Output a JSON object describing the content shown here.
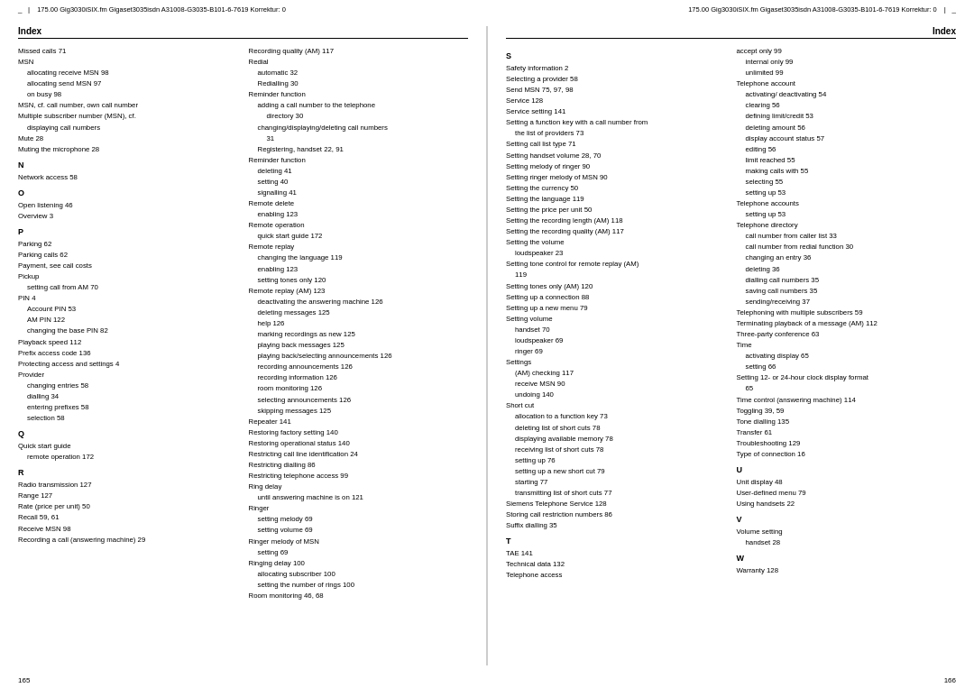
{
  "header": {
    "left_corner": "_",
    "left_info": "175.00    Gig3030iSIX.fm  Gigaset3035isdn  A31008-G3035-B101-6-7619  Korrektur: 0",
    "right_info": "175.00    Gig3030iSIX.fm  Gigaset3035isdn  A31008-G3035-B101-6-7619  Korrektur: 0",
    "right_corner": "_"
  },
  "left_page": {
    "title": "Index",
    "page_number": "165",
    "columns": {
      "col1": [
        {
          "type": "text",
          "content": "Missed calls 71"
        },
        {
          "type": "text",
          "content": "MSN"
        },
        {
          "type": "indent1",
          "content": "allocating receive MSN 98"
        },
        {
          "type": "indent1",
          "content": "allocating send MSN 97"
        },
        {
          "type": "indent1",
          "content": "on busy 98"
        },
        {
          "type": "text",
          "content": "MSN, cf. call number, own call number"
        },
        {
          "type": "text",
          "content": "Multiple subscriber number (MSN), cf."
        },
        {
          "type": "indent1",
          "content": "displaying call numbers"
        },
        {
          "type": "text",
          "content": "Mute 28"
        },
        {
          "type": "text",
          "content": "Muting the microphone 28"
        },
        {
          "type": "section",
          "content": "N"
        },
        {
          "type": "text",
          "content": "Network access 58"
        },
        {
          "type": "section",
          "content": "O"
        },
        {
          "type": "text",
          "content": "Open listening 46"
        },
        {
          "type": "text",
          "content": "Overview 3"
        },
        {
          "type": "section",
          "content": "P"
        },
        {
          "type": "text",
          "content": "Parking 62"
        },
        {
          "type": "text",
          "content": "Parking calls 62"
        },
        {
          "type": "text",
          "content": "Payment, see call costs"
        },
        {
          "type": "text",
          "content": "Pickup"
        },
        {
          "type": "indent1",
          "content": "setting call from AM 70"
        },
        {
          "type": "text",
          "content": "PIN 4"
        },
        {
          "type": "indent1",
          "content": "Account PIN 53"
        },
        {
          "type": "indent1",
          "content": "AM PIN 122"
        },
        {
          "type": "indent1",
          "content": "changing the base PIN 82"
        },
        {
          "type": "text",
          "content": "Playback speed 112"
        },
        {
          "type": "text",
          "content": "Prefix access code 136"
        },
        {
          "type": "text",
          "content": "Protecting access and settings 4"
        },
        {
          "type": "text",
          "content": "Provider"
        },
        {
          "type": "indent1",
          "content": "changing entries 58"
        },
        {
          "type": "indent1",
          "content": "dialling 34"
        },
        {
          "type": "indent1",
          "content": "entering prefixes 58"
        },
        {
          "type": "indent1",
          "content": "selection 58"
        },
        {
          "type": "section",
          "content": "Q"
        },
        {
          "type": "text",
          "content": "Quick start guide"
        },
        {
          "type": "indent1",
          "content": "remote operation 172"
        },
        {
          "type": "section",
          "content": "R"
        },
        {
          "type": "text",
          "content": "Radio transmission 127"
        },
        {
          "type": "text",
          "content": "Range 127"
        },
        {
          "type": "text",
          "content": "Rate (price per unit) 50"
        },
        {
          "type": "text",
          "content": "Recall 59, 61"
        },
        {
          "type": "text",
          "content": "Receive MSN 98"
        },
        {
          "type": "text",
          "content": "Recording a call (answering machine) 29"
        }
      ],
      "col2": [
        {
          "type": "text",
          "content": "Recording quality (AM) 117"
        },
        {
          "type": "text",
          "content": "Redial"
        },
        {
          "type": "indent1",
          "content": "automatic 32"
        },
        {
          "type": "indent1",
          "content": "Redialling 30"
        },
        {
          "type": "text",
          "content": "Reminder function"
        },
        {
          "type": "indent1",
          "content": "adding a call number to the telephone"
        },
        {
          "type": "indent2",
          "content": "directory 30"
        },
        {
          "type": "indent1",
          "content": "changing/displaying/deleting call numbers"
        },
        {
          "type": "indent2",
          "content": "31"
        },
        {
          "type": "indent1",
          "content": "Registering, handset 22, 91"
        },
        {
          "type": "text",
          "content": "Reminder function"
        },
        {
          "type": "indent1",
          "content": "deleting 41"
        },
        {
          "type": "indent1",
          "content": "setting 40"
        },
        {
          "type": "indent1",
          "content": "signalling 41"
        },
        {
          "type": "text",
          "content": "Remote delete"
        },
        {
          "type": "indent1",
          "content": "enabling 123"
        },
        {
          "type": "text",
          "content": "Remote operation"
        },
        {
          "type": "indent1",
          "content": "quick start guide 172"
        },
        {
          "type": "text",
          "content": "Remote replay"
        },
        {
          "type": "indent1",
          "content": "changing the language 119"
        },
        {
          "type": "indent1",
          "content": "enabling 123"
        },
        {
          "type": "indent1",
          "content": "setting tones only 120"
        },
        {
          "type": "text",
          "content": "Remote replay (AM) 123"
        },
        {
          "type": "indent1",
          "content": "deactivating the answering machine 126"
        },
        {
          "type": "indent1",
          "content": "deleting messages 125"
        },
        {
          "type": "indent1",
          "content": "help 126"
        },
        {
          "type": "indent1",
          "content": "marking recordings as new 125"
        },
        {
          "type": "indent1",
          "content": "playing back messages 125"
        },
        {
          "type": "indent1",
          "content": "playing back/selecting announcements 126"
        },
        {
          "type": "indent1",
          "content": "recording announcements 126"
        },
        {
          "type": "indent1",
          "content": "recording information 126"
        },
        {
          "type": "indent1",
          "content": "room monitoring 126"
        },
        {
          "type": "indent1",
          "content": "selecting announcements 126"
        },
        {
          "type": "indent1",
          "content": "skipping messages 125"
        },
        {
          "type": "text",
          "content": "Repeater 141"
        },
        {
          "type": "text",
          "content": "Restoring factory setting 140"
        },
        {
          "type": "text",
          "content": "Restoring operational status 140"
        },
        {
          "type": "text",
          "content": "Restricting call line identification 24"
        },
        {
          "type": "text",
          "content": "Restricting dialling 86"
        },
        {
          "type": "text",
          "content": "Restricting telephone access 99"
        },
        {
          "type": "text",
          "content": "Ring delay"
        },
        {
          "type": "indent1",
          "content": "until answering machine is on 121"
        },
        {
          "type": "text",
          "content": "Ringer"
        },
        {
          "type": "indent1",
          "content": "setting melody 69"
        },
        {
          "type": "indent1",
          "content": "setting volume 69"
        },
        {
          "type": "text",
          "content": "Ringer melody of MSN"
        },
        {
          "type": "indent1",
          "content": "setting 69"
        },
        {
          "type": "text",
          "content": "Ringing delay 100"
        },
        {
          "type": "indent1",
          "content": "allocating subscriber 100"
        },
        {
          "type": "indent1",
          "content": "setting the number of rings 100"
        },
        {
          "type": "text",
          "content": "Room monitoring 46, 68"
        }
      ]
    }
  },
  "right_page": {
    "title": "Index",
    "page_number": "166",
    "columns": {
      "col1": [
        {
          "type": "section",
          "content": "S"
        },
        {
          "type": "text",
          "content": "Safety information 2"
        },
        {
          "type": "text",
          "content": "Selecting a provider 58"
        },
        {
          "type": "text",
          "content": "Send MSN 75, 97, 98"
        },
        {
          "type": "text",
          "content": "Service 128"
        },
        {
          "type": "text",
          "content": "Service setting 141"
        },
        {
          "type": "text",
          "content": "Setting a function key with a call number from"
        },
        {
          "type": "indent1",
          "content": "the list of providers 73"
        },
        {
          "type": "text",
          "content": "Setting call list type 71"
        },
        {
          "type": "text",
          "content": "Setting handset volume 28, 70"
        },
        {
          "type": "text",
          "content": "Setting melody of ringer 90"
        },
        {
          "type": "text",
          "content": "Setting ringer melody of MSN 90"
        },
        {
          "type": "text",
          "content": "Setting the currency 50"
        },
        {
          "type": "text",
          "content": "Setting the language 119"
        },
        {
          "type": "text",
          "content": "Setting the price per unit 50"
        },
        {
          "type": "text",
          "content": "Setting the recording length (AM) 118"
        },
        {
          "type": "text",
          "content": "Setting the recording quality (AM) 117"
        },
        {
          "type": "text",
          "content": "Setting the volume"
        },
        {
          "type": "indent1",
          "content": "loudspeaker 23"
        },
        {
          "type": "text",
          "content": "Setting tone control for remote replay (AM)"
        },
        {
          "type": "indent1",
          "content": "119"
        },
        {
          "type": "text",
          "content": "Setting tones only (AM) 120"
        },
        {
          "type": "text",
          "content": "Setting up a connection 88"
        },
        {
          "type": "text",
          "content": "Setting up a new menu 79"
        },
        {
          "type": "text",
          "content": "Setting volume"
        },
        {
          "type": "indent1",
          "content": "handset 70"
        },
        {
          "type": "indent1",
          "content": "loudspeaker 69"
        },
        {
          "type": "indent1",
          "content": "ringer 69"
        },
        {
          "type": "text",
          "content": "Settings"
        },
        {
          "type": "indent1",
          "content": "(AM) checking 117"
        },
        {
          "type": "indent1",
          "content": "receive MSN 90"
        },
        {
          "type": "indent1",
          "content": "undoing 140"
        },
        {
          "type": "text",
          "content": "Short cut"
        },
        {
          "type": "indent1",
          "content": "allocation to a function key 73"
        },
        {
          "type": "indent1",
          "content": "deleting list of short cuts 78"
        },
        {
          "type": "indent1",
          "content": "displaying available memory 78"
        },
        {
          "type": "indent1",
          "content": "receiving list of short cuts 78"
        },
        {
          "type": "indent1",
          "content": "setting up 76"
        },
        {
          "type": "indent1",
          "content": "setting up a new short cut 79"
        },
        {
          "type": "indent1",
          "content": "starting 77"
        },
        {
          "type": "indent1",
          "content": "transmitting list of short cuts 77"
        },
        {
          "type": "text",
          "content": "Siemens Telephone Service 128"
        },
        {
          "type": "text",
          "content": "Storing call restriction numbers 86"
        },
        {
          "type": "text",
          "content": "Suffix dialling 35"
        },
        {
          "type": "section",
          "content": "T"
        },
        {
          "type": "text",
          "content": "TAE 141"
        },
        {
          "type": "text",
          "content": "Technical data 132"
        },
        {
          "type": "text",
          "content": "Telephone access"
        }
      ],
      "col2": [
        {
          "type": "text",
          "content": "accept only 99"
        },
        {
          "type": "indent1",
          "content": "internal only 99"
        },
        {
          "type": "indent1",
          "content": "unlimited 99"
        },
        {
          "type": "text",
          "content": "Telephone account"
        },
        {
          "type": "indent1",
          "content": "activating/ deactivating 54"
        },
        {
          "type": "indent1",
          "content": "clearing 56"
        },
        {
          "type": "indent1",
          "content": "defining limit/credit 53"
        },
        {
          "type": "indent1",
          "content": "deleting amount 56"
        },
        {
          "type": "indent1",
          "content": "display account status 57"
        },
        {
          "type": "indent1",
          "content": "editing 56"
        },
        {
          "type": "indent1",
          "content": "limit reached 55"
        },
        {
          "type": "indent1",
          "content": "making calls with 55"
        },
        {
          "type": "indent1",
          "content": "selecting 55"
        },
        {
          "type": "indent1",
          "content": "setting up 53"
        },
        {
          "type": "text",
          "content": "Telephone accounts"
        },
        {
          "type": "indent1",
          "content": "setting up 53"
        },
        {
          "type": "text",
          "content": "Telephone directory"
        },
        {
          "type": "indent1",
          "content": "call number from caller list 33"
        },
        {
          "type": "indent1",
          "content": "call number from redial function 30"
        },
        {
          "type": "indent1",
          "content": "changing an entry 36"
        },
        {
          "type": "indent1",
          "content": "deleting 36"
        },
        {
          "type": "indent1",
          "content": "dialling call numbers 35"
        },
        {
          "type": "indent1",
          "content": "saving call numbers 35"
        },
        {
          "type": "indent1",
          "content": "sending/receiving 37"
        },
        {
          "type": "text",
          "content": "Telephoning with multiple subscribers 59"
        },
        {
          "type": "text",
          "content": "Terminating playback of a message (AM) 112"
        },
        {
          "type": "text",
          "content": "Three-party conference 63"
        },
        {
          "type": "text",
          "content": "Time"
        },
        {
          "type": "indent1",
          "content": "activating display 65"
        },
        {
          "type": "indent1",
          "content": "setting 66"
        },
        {
          "type": "text",
          "content": "Setting 12- or 24-hour clock display format"
        },
        {
          "type": "indent1",
          "content": "65"
        },
        {
          "type": "text",
          "content": "Time control (answering machine) 114"
        },
        {
          "type": "text",
          "content": "Toggling 39, 59"
        },
        {
          "type": "text",
          "content": "Tone dialling 135"
        },
        {
          "type": "text",
          "content": "Transfer 61"
        },
        {
          "type": "text",
          "content": "Troubleshooting 129"
        },
        {
          "type": "text",
          "content": "Type of connection 16"
        },
        {
          "type": "section",
          "content": "U"
        },
        {
          "type": "text",
          "content": "Unit display 48"
        },
        {
          "type": "text",
          "content": "User-defined menu 79"
        },
        {
          "type": "text",
          "content": "Using handsets 22"
        },
        {
          "type": "section",
          "content": "V"
        },
        {
          "type": "text",
          "content": "Volume setting"
        },
        {
          "type": "indent1",
          "content": "handset 28"
        },
        {
          "type": "section",
          "content": "W"
        },
        {
          "type": "text",
          "content": "Warranty 128"
        }
      ]
    }
  }
}
